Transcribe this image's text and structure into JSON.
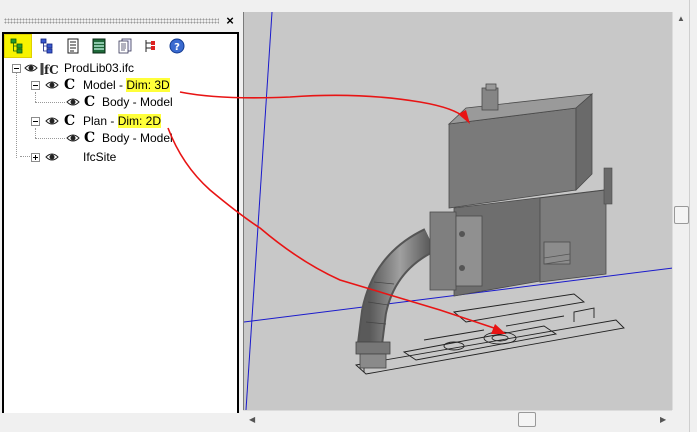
{
  "pane": {
    "close_label": "×"
  },
  "toolbar": {
    "buttons": [
      "tree-view-icon",
      "hierarchy-icon",
      "properties-icon",
      "layers-icon",
      "documents-icon",
      "filter-icon",
      "help-icon"
    ]
  },
  "tree": {
    "root": {
      "label": "ProdLib03.ifc",
      "icon": "ifc-file-icon"
    },
    "model": {
      "prefix": "Model - ",
      "dim": "Dim: 3D"
    },
    "model_child": {
      "label": "Body - Model"
    },
    "plan": {
      "prefix": "Plan - ",
      "dim": "Dim: 2D"
    },
    "plan_child": {
      "label": "Body - Model"
    },
    "site": {
      "label": "IfcSite"
    },
    "c_glyph": "C"
  },
  "colors": {
    "highlight": "#ffff3a",
    "annotation_arrow": "#e81414",
    "axis_line": "#1a1acc",
    "model_body": "#7a7a7a",
    "viewport_bg": "#c8c8c8"
  }
}
